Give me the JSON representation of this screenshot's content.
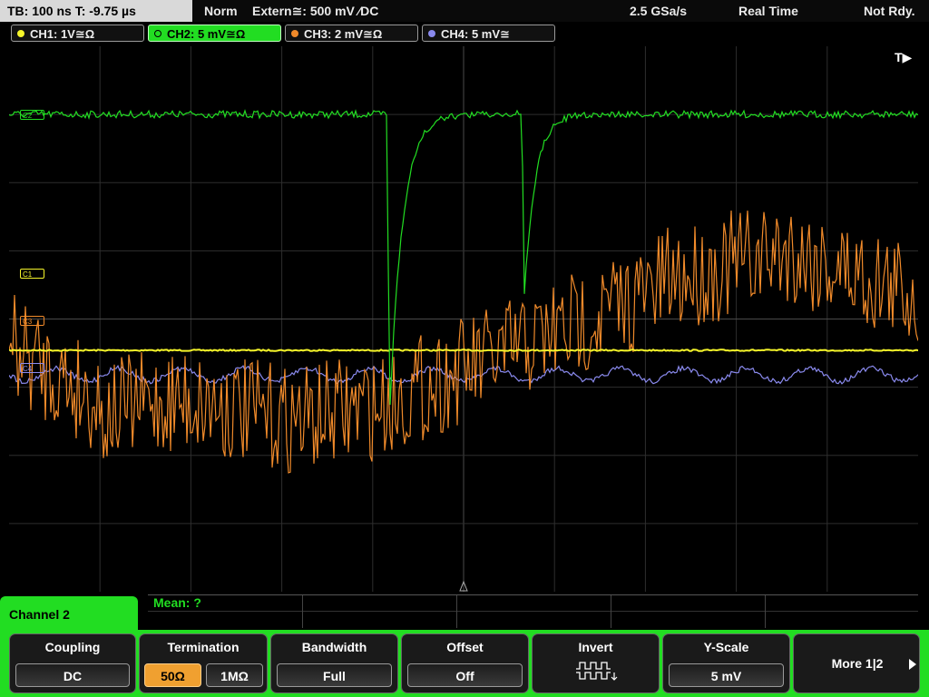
{
  "status": {
    "timebase": "TB: 100 ns   T: -9.75 µs",
    "trigger_mode": "Norm",
    "trigger_source": "Extern≅: 500 mV ⁄DC",
    "sample_rate": "2.5 GSa/s",
    "acq_mode": "Real Time",
    "state": "Not Rdy."
  },
  "channels": [
    {
      "label": "CH1: 1V≅Ω",
      "color": "#f5f52a",
      "tag": "C1"
    },
    {
      "label": "CH2: 5 mV≅Ω",
      "color": "#22dd22",
      "tag": "C2"
    },
    {
      "label": "CH3: 2 mV≅Ω",
      "color": "#f08a2a",
      "tag": "C3"
    },
    {
      "label": "CH4: 5 mV≅",
      "color": "#8a8aee",
      "tag": "C4"
    }
  ],
  "trigger_marker": "T▶",
  "measurement": {
    "label": "Mean: ?"
  },
  "panel_title": "Channel 2",
  "softkeys": {
    "coupling": {
      "title": "Coupling",
      "value": "DC"
    },
    "termination": {
      "title": "Termination",
      "opt1": "50Ω",
      "opt2": "1MΩ"
    },
    "bandwidth": {
      "title": "Bandwidth",
      "value": "Full"
    },
    "offset": {
      "title": "Offset",
      "value": "Off"
    },
    "invert": {
      "title": "Invert"
    },
    "yscale": {
      "title": "Y-Scale",
      "value": "5 mV"
    },
    "more": {
      "label": "More 1|2"
    }
  },
  "colors": {
    "accent": "#22dd22",
    "selected": "#f0a030"
  }
}
